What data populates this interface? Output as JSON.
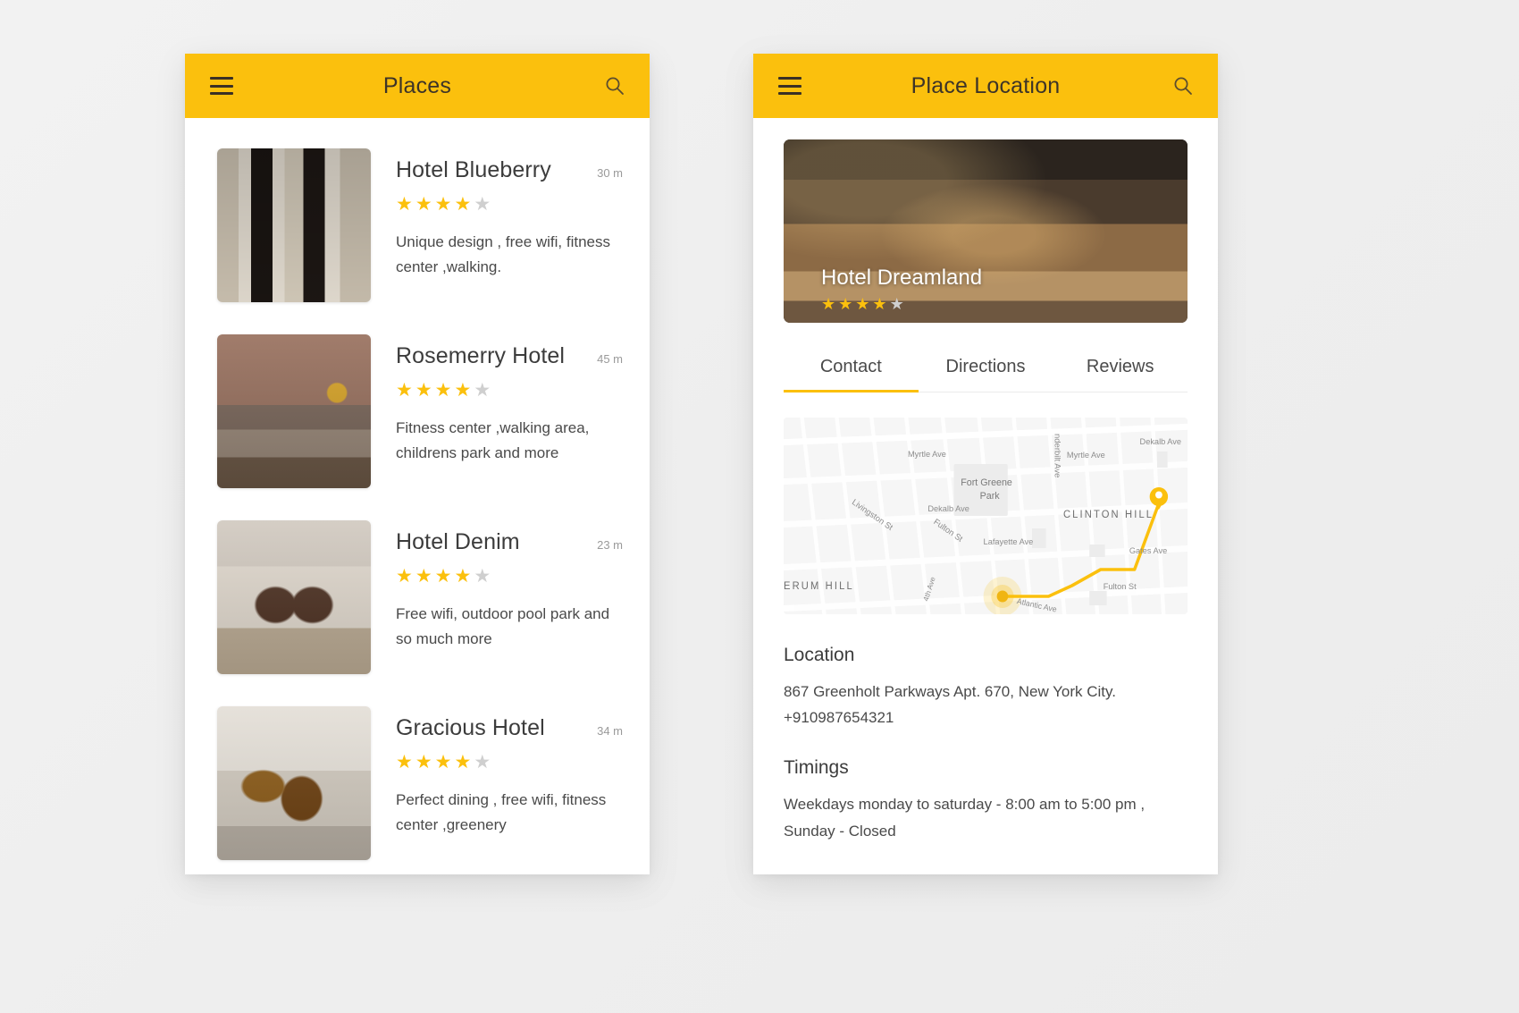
{
  "theme": {
    "accent": "#FBC00D",
    "bg": "#f0f0f0",
    "card": "#ffffff",
    "star_on": "#FBC00D",
    "star_off": "#cfcfcf",
    "text": "#3c3c3c",
    "muted": "#9a9a9a"
  },
  "left_screen": {
    "appbar": {
      "menu_icon": "hamburger-icon",
      "title": "Places",
      "search_icon": "search-icon"
    },
    "places": [
      {
        "name": "Hotel Blueberry",
        "distance": "30 m",
        "rating": 4,
        "max_rating": 5,
        "description": "Unique design , free  wifi, fitness center ,walking."
      },
      {
        "name": "Rosemerry Hotel",
        "distance": "45 m",
        "rating": 4,
        "max_rating": 5,
        "description": "Fitness center ,walking area, childrens park and more"
      },
      {
        "name": "Hotel Denim",
        "distance": "23 m",
        "rating": 4,
        "max_rating": 5,
        "description": "Free  wifi, outdoor pool park and so much more"
      },
      {
        "name": "Gracious Hotel",
        "distance": "34 m",
        "rating": 4,
        "max_rating": 5,
        "description": "Perfect dining , free  wifi, fitness center ,greenery"
      }
    ]
  },
  "right_screen": {
    "appbar": {
      "menu_icon": "hamburger-icon",
      "title": "Place Location",
      "search_icon": "search-icon"
    },
    "hero": {
      "caption": "Hotel Dreamland",
      "rating": 4,
      "max_rating": 5
    },
    "tabs": [
      {
        "label": "Contact",
        "active": true
      },
      {
        "label": "Directions",
        "active": false
      },
      {
        "label": "Reviews",
        "active": false
      }
    ],
    "map": {
      "labels": [
        "Myrtle Ave",
        "Fort Greene Park",
        "Vanderbilt Ave",
        "Myrtle Ave",
        "Dekalb Ave",
        "Dekalb Ave",
        "CLINTON HILL",
        "Livingston St",
        "Fulton St",
        "Lafayette Ave",
        "ERUM HILL",
        "Gates Ave",
        "Fulton St",
        "4th Ave",
        "Atlantic Ave"
      ],
      "route_color": "#FBC00D",
      "pin_label": "map-pin"
    },
    "info": {
      "location_heading": "Location",
      "address": "867 Greenholt Parkways Apt. 670, New York City.",
      "phone": "+910987654321",
      "timings_heading": "Timings",
      "timings": "Weekdays  monday to saturday - 8:00 am to 5:00 pm , Sunday - Closed"
    }
  }
}
